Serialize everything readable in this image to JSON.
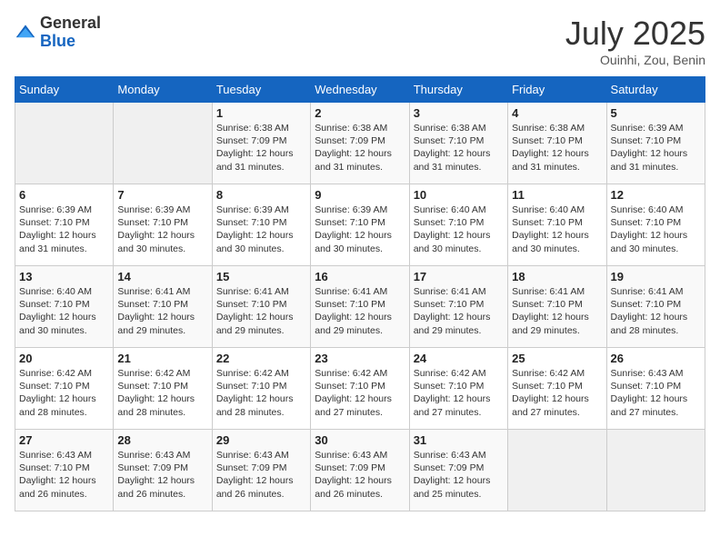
{
  "logo": {
    "general": "General",
    "blue": "Blue"
  },
  "title": "July 2025",
  "subtitle": "Ouinhi, Zou, Benin",
  "days_of_week": [
    "Sunday",
    "Monday",
    "Tuesday",
    "Wednesday",
    "Thursday",
    "Friday",
    "Saturday"
  ],
  "weeks": [
    [
      {
        "day": "",
        "info": ""
      },
      {
        "day": "",
        "info": ""
      },
      {
        "day": "1",
        "info": "Sunrise: 6:38 AM\nSunset: 7:09 PM\nDaylight: 12 hours and 31 minutes."
      },
      {
        "day": "2",
        "info": "Sunrise: 6:38 AM\nSunset: 7:09 PM\nDaylight: 12 hours and 31 minutes."
      },
      {
        "day": "3",
        "info": "Sunrise: 6:38 AM\nSunset: 7:10 PM\nDaylight: 12 hours and 31 minutes."
      },
      {
        "day": "4",
        "info": "Sunrise: 6:38 AM\nSunset: 7:10 PM\nDaylight: 12 hours and 31 minutes."
      },
      {
        "day": "5",
        "info": "Sunrise: 6:39 AM\nSunset: 7:10 PM\nDaylight: 12 hours and 31 minutes."
      }
    ],
    [
      {
        "day": "6",
        "info": "Sunrise: 6:39 AM\nSunset: 7:10 PM\nDaylight: 12 hours and 31 minutes."
      },
      {
        "day": "7",
        "info": "Sunrise: 6:39 AM\nSunset: 7:10 PM\nDaylight: 12 hours and 30 minutes."
      },
      {
        "day": "8",
        "info": "Sunrise: 6:39 AM\nSunset: 7:10 PM\nDaylight: 12 hours and 30 minutes."
      },
      {
        "day": "9",
        "info": "Sunrise: 6:39 AM\nSunset: 7:10 PM\nDaylight: 12 hours and 30 minutes."
      },
      {
        "day": "10",
        "info": "Sunrise: 6:40 AM\nSunset: 7:10 PM\nDaylight: 12 hours and 30 minutes."
      },
      {
        "day": "11",
        "info": "Sunrise: 6:40 AM\nSunset: 7:10 PM\nDaylight: 12 hours and 30 minutes."
      },
      {
        "day": "12",
        "info": "Sunrise: 6:40 AM\nSunset: 7:10 PM\nDaylight: 12 hours and 30 minutes."
      }
    ],
    [
      {
        "day": "13",
        "info": "Sunrise: 6:40 AM\nSunset: 7:10 PM\nDaylight: 12 hours and 30 minutes."
      },
      {
        "day": "14",
        "info": "Sunrise: 6:41 AM\nSunset: 7:10 PM\nDaylight: 12 hours and 29 minutes."
      },
      {
        "day": "15",
        "info": "Sunrise: 6:41 AM\nSunset: 7:10 PM\nDaylight: 12 hours and 29 minutes."
      },
      {
        "day": "16",
        "info": "Sunrise: 6:41 AM\nSunset: 7:10 PM\nDaylight: 12 hours and 29 minutes."
      },
      {
        "day": "17",
        "info": "Sunrise: 6:41 AM\nSunset: 7:10 PM\nDaylight: 12 hours and 29 minutes."
      },
      {
        "day": "18",
        "info": "Sunrise: 6:41 AM\nSunset: 7:10 PM\nDaylight: 12 hours and 29 minutes."
      },
      {
        "day": "19",
        "info": "Sunrise: 6:41 AM\nSunset: 7:10 PM\nDaylight: 12 hours and 28 minutes."
      }
    ],
    [
      {
        "day": "20",
        "info": "Sunrise: 6:42 AM\nSunset: 7:10 PM\nDaylight: 12 hours and 28 minutes."
      },
      {
        "day": "21",
        "info": "Sunrise: 6:42 AM\nSunset: 7:10 PM\nDaylight: 12 hours and 28 minutes."
      },
      {
        "day": "22",
        "info": "Sunrise: 6:42 AM\nSunset: 7:10 PM\nDaylight: 12 hours and 28 minutes."
      },
      {
        "day": "23",
        "info": "Sunrise: 6:42 AM\nSunset: 7:10 PM\nDaylight: 12 hours and 27 minutes."
      },
      {
        "day": "24",
        "info": "Sunrise: 6:42 AM\nSunset: 7:10 PM\nDaylight: 12 hours and 27 minutes."
      },
      {
        "day": "25",
        "info": "Sunrise: 6:42 AM\nSunset: 7:10 PM\nDaylight: 12 hours and 27 minutes."
      },
      {
        "day": "26",
        "info": "Sunrise: 6:43 AM\nSunset: 7:10 PM\nDaylight: 12 hours and 27 minutes."
      }
    ],
    [
      {
        "day": "27",
        "info": "Sunrise: 6:43 AM\nSunset: 7:10 PM\nDaylight: 12 hours and 26 minutes."
      },
      {
        "day": "28",
        "info": "Sunrise: 6:43 AM\nSunset: 7:09 PM\nDaylight: 12 hours and 26 minutes."
      },
      {
        "day": "29",
        "info": "Sunrise: 6:43 AM\nSunset: 7:09 PM\nDaylight: 12 hours and 26 minutes."
      },
      {
        "day": "30",
        "info": "Sunrise: 6:43 AM\nSunset: 7:09 PM\nDaylight: 12 hours and 26 minutes."
      },
      {
        "day": "31",
        "info": "Sunrise: 6:43 AM\nSunset: 7:09 PM\nDaylight: 12 hours and 25 minutes."
      },
      {
        "day": "",
        "info": ""
      },
      {
        "day": "",
        "info": ""
      }
    ]
  ]
}
